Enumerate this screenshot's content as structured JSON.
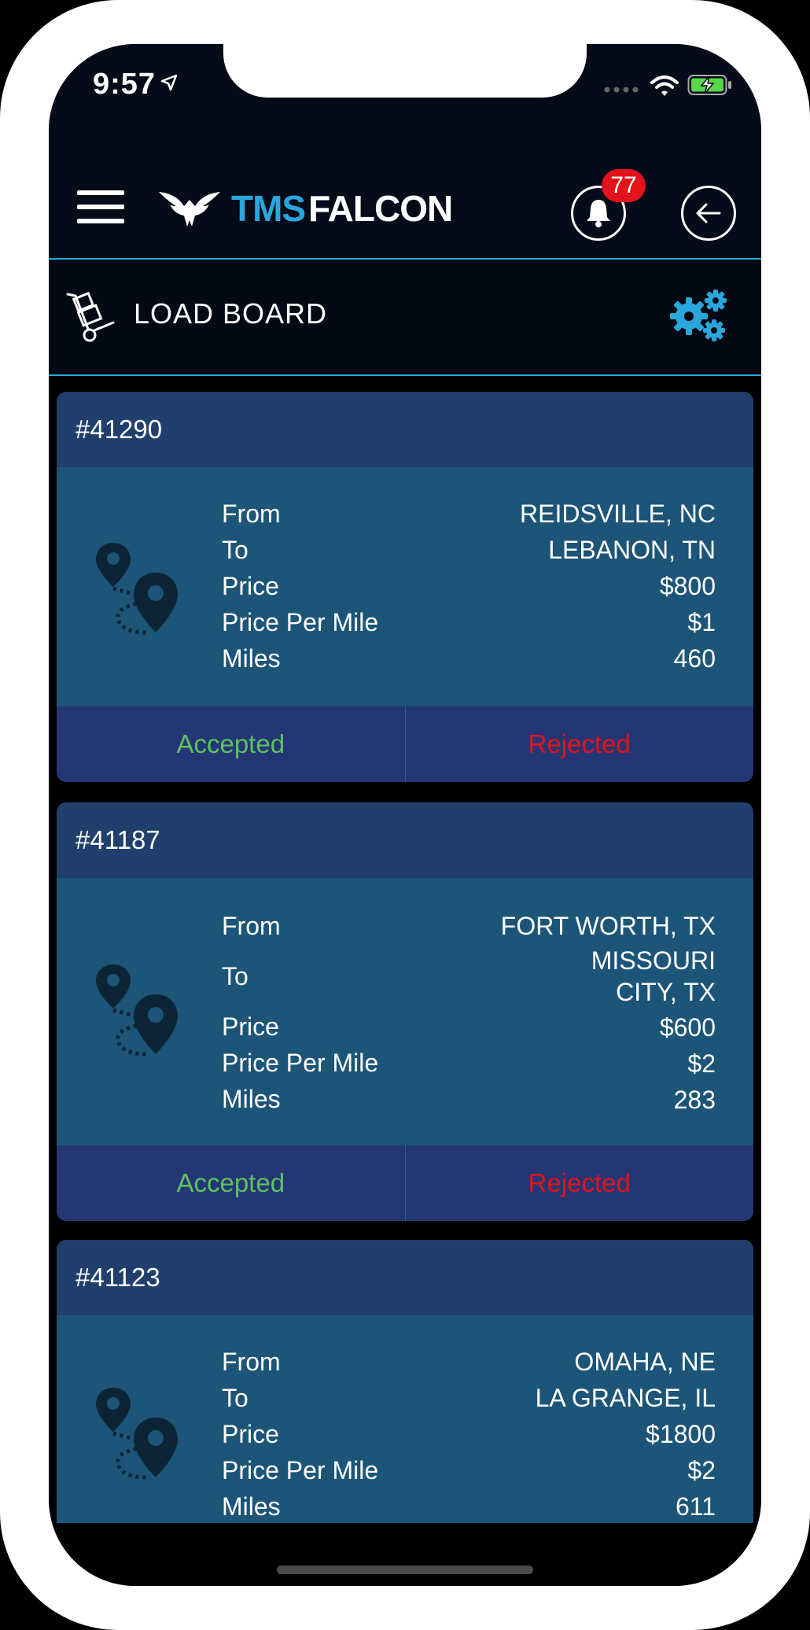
{
  "status_bar": {
    "time": "9:57"
  },
  "header": {
    "logo_tms": "TMS",
    "logo_falcon": "FALCON",
    "notification_count": "77"
  },
  "page": {
    "title": "LOAD BOARD"
  },
  "field_labels": {
    "from": "From",
    "to": "To",
    "price": "Price",
    "price_per_mile": "Price Per Mile",
    "miles": "Miles"
  },
  "actions": {
    "accepted": "Accepted",
    "rejected": "Rejected"
  },
  "loads": [
    {
      "id": "#41290",
      "from": "REIDSVILLE, NC",
      "to_line1": "LEBANON, TN",
      "to_line2": "",
      "price": "$800",
      "price_per_mile": "$1",
      "miles": "460"
    },
    {
      "id": "#41187",
      "from": "FORT WORTH, TX",
      "to_line1": "MISSOURI",
      "to_line2": "CITY, TX",
      "price": "$600",
      "price_per_mile": "$2",
      "miles": "283"
    },
    {
      "id": "#41123",
      "from": "OMAHA, NE",
      "to_line1": "LA GRANGE, IL",
      "to_line2": "",
      "price": "$1800",
      "price_per_mile": "$2",
      "miles": "611"
    }
  ],
  "colors": {
    "accent": "#29a7dc",
    "accepted": "#5cc35f",
    "rejected": "#e3121b",
    "card_header": "#203f6c",
    "card_body": "#1c5577",
    "card_footer": "#243673"
  }
}
